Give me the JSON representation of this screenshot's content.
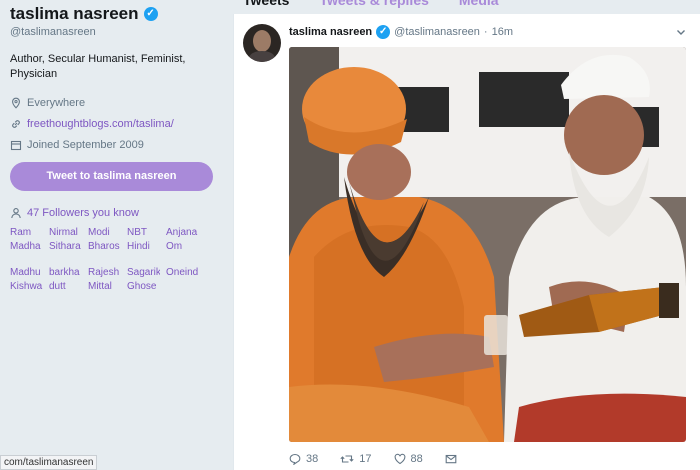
{
  "profile": {
    "name": "taslima nasreen",
    "handle": "@taslimanasreen",
    "bio": "Author, Secular Humanist, Feminist, Physician",
    "location": "Everywhere",
    "website": "freethoughtblogs.com/taslima/",
    "joined": "Joined September 2009",
    "tweet_to_label": "Tweet to taslima nasreen",
    "followers_you_know": "47 Followers you know",
    "known": [
      [
        "Ram",
        "Madha"
      ],
      [
        "Nirmal",
        "Sithara"
      ],
      [
        "Modi",
        "Bharos"
      ],
      [
        "NBT",
        "Hindi"
      ],
      [
        "Anjana",
        "Om"
      ],
      [
        "Madhu",
        "Kishwa"
      ],
      [
        "barkha",
        "dutt"
      ],
      [
        "Rajesh",
        "Mittal"
      ],
      [
        "Sagarik",
        "Ghose"
      ],
      [
        "Oneind",
        ""
      ]
    ]
  },
  "status_url": "com/taslimanasreen",
  "tabs": [
    "Tweets",
    "Tweets & replies",
    "Media"
  ],
  "tweet": {
    "name": "taslima nasreen",
    "handle": "@taslimanasreen",
    "sep": "·",
    "time": "16m",
    "replies": "38",
    "retweets": "17",
    "likes": "88"
  },
  "icons": {
    "verified": "verified-badge-icon",
    "location": "location-pin-icon",
    "link": "link-icon",
    "calendar": "calendar-icon",
    "people": "people-icon",
    "chevron": "chevron-down-icon",
    "reply": "reply-icon",
    "retweet": "retweet-icon",
    "like": "heart-icon",
    "message": "envelope-icon"
  },
  "colors": {
    "accent": "#7e57c2",
    "button": "#a98ad9",
    "verified": "#1da1f2",
    "background": "#e6ecf0"
  }
}
